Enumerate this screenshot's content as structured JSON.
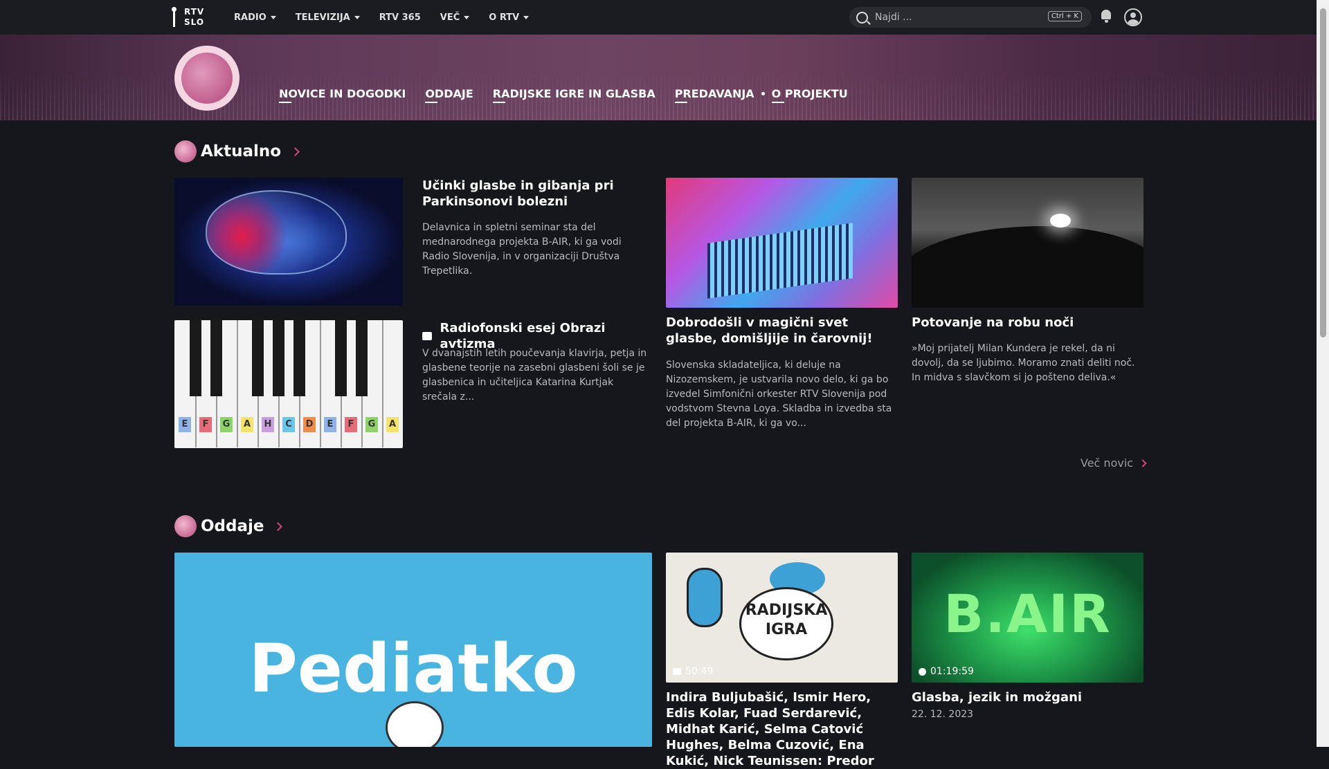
{
  "topnav": {
    "logo_line1": "RTV",
    "logo_line2": "SLO",
    "items": [
      "RADIO",
      "TELEVIZIJA",
      "RTV 365",
      "VEČ",
      "O RTV"
    ],
    "search_placeholder": "Najdi ...",
    "search_shortcut": "Ctrl + K"
  },
  "banner": {
    "subnav": [
      "NOVICE IN DOGODKI",
      "ODDAJE",
      "RADIJSKE IGRE IN GLASBA",
      "PREDAVANJA",
      "O PROJEKTU"
    ]
  },
  "aktualno": {
    "title": "Aktualno",
    "articles": [
      {
        "title": "Učinki glasbe in gibanja pri Parkinsonovi bolezni",
        "text": "Delavnica in spletni seminar sta del mednarodnega projekta B-AIR, ki ga vodi Radio Slovenija, in v organizaciji Društva Trepetlika."
      },
      {
        "title": "Radiofonski esej Obrazi avtizma",
        "text": "V dvanajstih letih poučevanja klavirja, petja in glasbene teorije na zasebni glasbeni šoli se je glasbenica in učiteljica Katarina Kurtjak srečala z..."
      },
      {
        "title": "Dobrodošli v magični svet glasbe, domišljije in čarovnij!",
        "text": "Slovenska skladateljica, ki deluje na Nizozemskem, je ustvarila novo delo, ki ga bo izvedel Simfonični orkester RTV Slovenija pod vodstvom Stevna Loya. Skladba in izvedba sta del projekta B-AIR, ki ga vo..."
      },
      {
        "title": "Potovanje na robu noči",
        "text": "»Moj prijatelj Milan Kundera je rekel, da ni dovolj, da se ljubimo. Moramo znati deliti noč. In midva s slavčkom si jo pošteno deliva.«"
      }
    ],
    "more_label": "Več novic",
    "piano_labels": [
      "E",
      "F",
      "G",
      "A",
      "H",
      "C",
      "D",
      "E",
      "F",
      "G",
      "A"
    ]
  },
  "oddaje": {
    "title": "Oddaje",
    "cards": [
      {
        "image_text": "Pediatko"
      },
      {
        "image_text": "RADIJSKA IGRA",
        "duration": "50:49",
        "title": "Indira Buljubašić, Ismir Hero, Edis Kolar, Fuad Serdarević, Midhat Karić, Selma Catović Hughes, Belma Cuzović, Ena Kukić, Nick Teunissen: Predor"
      },
      {
        "image_text": "B.AIR",
        "duration": "01:19:59",
        "title": "Glasba, jezik in možgani",
        "date": "22. 12. 2023"
      }
    ]
  },
  "colors": {
    "accent": "#d1477e",
    "background": "#16171d",
    "banner": "#6d4462"
  }
}
